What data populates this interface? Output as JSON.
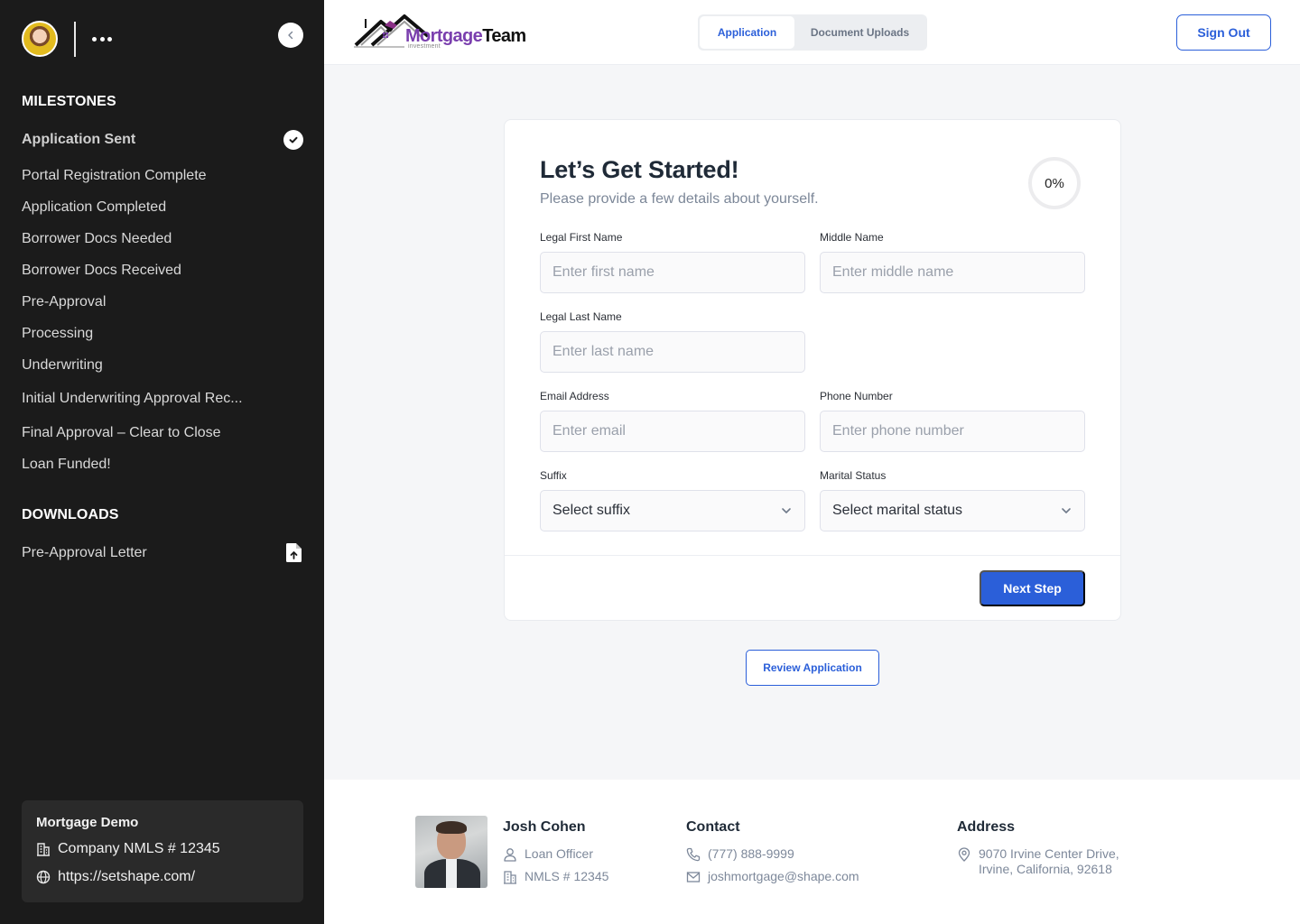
{
  "sidebar": {
    "more_label": "More options",
    "milestones_heading": "MILESTONES",
    "milestones": [
      {
        "label": "Application Sent",
        "completed": true
      },
      {
        "label": "Portal Registration Complete",
        "completed": false
      },
      {
        "label": "Application Completed",
        "completed": false
      },
      {
        "label": "Borrower Docs Needed",
        "completed": false
      },
      {
        "label": "Borrower Docs Received",
        "completed": false
      },
      {
        "label": "Pre-Approval",
        "completed": false
      },
      {
        "label": "Processing",
        "completed": false
      },
      {
        "label": "Underwriting",
        "completed": false
      },
      {
        "label": "Initial Underwriting Approval Rec...",
        "completed": false
      },
      {
        "label": "Final Approval – Clear to Close",
        "completed": false
      },
      {
        "label": "Loan Funded!",
        "completed": false
      }
    ],
    "downloads_heading": "DOWNLOADS",
    "downloads": [
      {
        "label": "Pre-Approval Letter",
        "icon": "file-upload-icon"
      }
    ],
    "company": {
      "name": "Mortgage Demo",
      "nmls": "Company NMLS # 12345",
      "website": "https://setshape.com/"
    }
  },
  "header": {
    "logo": {
      "brand_primary": "Mortgage",
      "brand_secondary": "Team",
      "tagline": "investment"
    },
    "tabs": [
      {
        "label": "Application",
        "active": true
      },
      {
        "label": "Document Uploads",
        "active": false
      }
    ],
    "sign_out_label": "Sign Out"
  },
  "form": {
    "title": "Let’s Get Started!",
    "subtitle": "Please provide a few details about yourself.",
    "progress_percent": 0,
    "progress_label": "0%",
    "fields": {
      "first_name": {
        "label": "Legal First Name",
        "placeholder": "Enter first name",
        "value": ""
      },
      "middle_name": {
        "label": "Middle Name",
        "placeholder": "Enter middle name",
        "value": ""
      },
      "last_name": {
        "label": "Legal Last Name",
        "placeholder": "Enter last name",
        "value": ""
      },
      "email": {
        "label": "Email Address",
        "placeholder": "Enter email",
        "value": ""
      },
      "phone": {
        "label": "Phone Number",
        "placeholder": "Enter phone number",
        "value": ""
      },
      "suffix": {
        "label": "Suffix",
        "selected": "Select suffix"
      },
      "marital_status": {
        "label": "Marital Status",
        "selected": "Select marital status"
      }
    },
    "next_label": "Next Step",
    "review_label": "Review Application"
  },
  "footer": {
    "officer": {
      "name": "Josh Cohen",
      "role": "Loan Officer",
      "nmls": "NMLS # 12345"
    },
    "contact": {
      "title": "Contact",
      "phone": "(777) 888-9999",
      "email": "joshmortgage@shape.com"
    },
    "address": {
      "title": "Address",
      "line1": "9070 Irvine Center Drive,",
      "line2": "Irvine, California, 92618"
    }
  },
  "colors": {
    "accent": "#2b5fd9",
    "sidebar_bg": "#1b1b1b",
    "page_bg": "#f5f6f8",
    "brand_purple": "#7a3fae"
  }
}
